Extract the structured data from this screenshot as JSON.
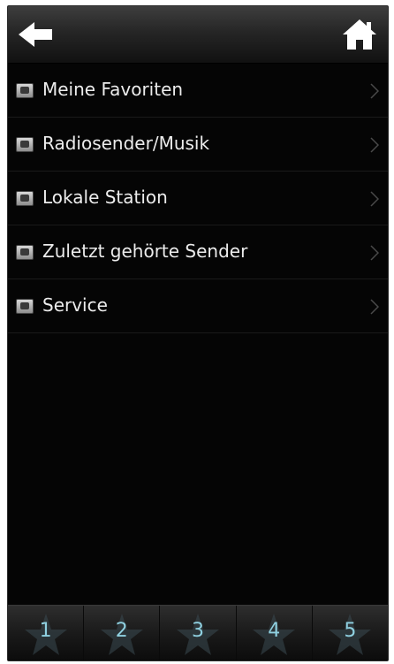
{
  "header": {
    "back_icon": "arrow-left-icon",
    "home_icon": "home-icon"
  },
  "menu": {
    "items": [
      {
        "label": "Meine Favoriten",
        "icon": "favorites-icon"
      },
      {
        "label": "Radiosender/Musik",
        "icon": "music-icon"
      },
      {
        "label": "Lokale Station",
        "icon": "local-station-icon"
      },
      {
        "label": "Zuletzt gehörte Sender",
        "icon": "history-icon"
      },
      {
        "label": "Service",
        "icon": "service-icon"
      }
    ]
  },
  "presets": {
    "items": [
      {
        "label": "1"
      },
      {
        "label": "2"
      },
      {
        "label": "3"
      },
      {
        "label": "4"
      },
      {
        "label": "5"
      }
    ]
  },
  "colors": {
    "background": "#050505",
    "text": "#ececec",
    "preset_number": "#8fd0e0"
  }
}
